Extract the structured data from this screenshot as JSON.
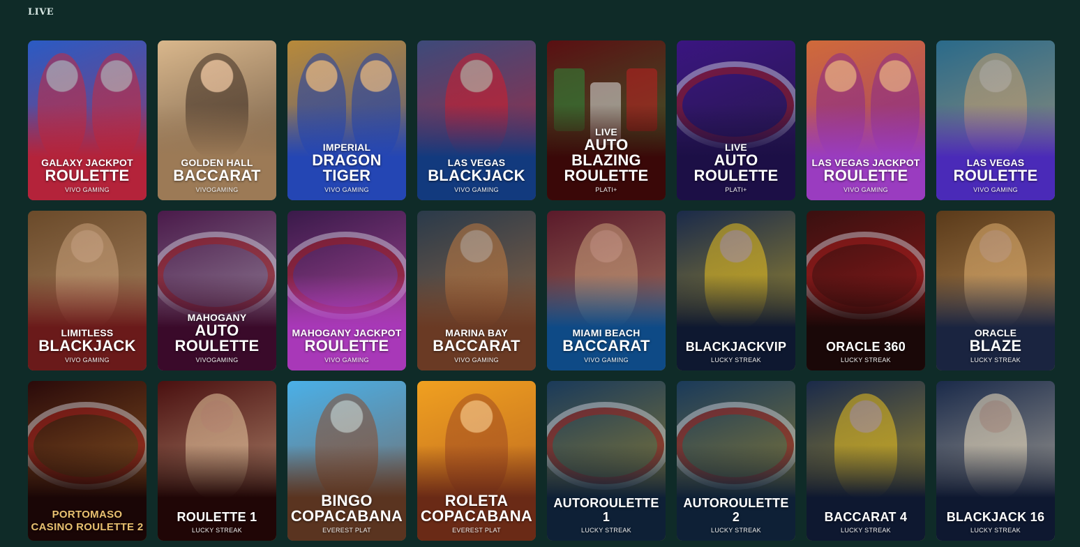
{
  "section": {
    "title": "LIVE"
  },
  "games": [
    {
      "top": "GALAXY JACKPOT",
      "main": "ROULETTE",
      "provider": "VIVO GAMING",
      "bg": "#2a5bc4",
      "accent": "#c62a3e",
      "shade": "#b4233a",
      "kind": "people",
      "name": "galaxy-jackpot-roulette"
    },
    {
      "top": "GOLDEN HALL",
      "main": "BACCARAT",
      "provider": "VIVOGAMING",
      "bg": "#d9b78c",
      "accent": "#3a2a20",
      "shade": "#9c7a56",
      "kind": "person",
      "name": "golden-hall-baccarat"
    },
    {
      "top": "IMPERIAL",
      "main": "DRAGON\nTIGER",
      "provider": "VIVO GAMING",
      "bg": "#b88a3a",
      "accent": "#1d3fa8",
      "shade": "#2446b4",
      "kind": "people",
      "name": "imperial-dragon-tiger"
    },
    {
      "top": "LAS VEGAS",
      "main": "BLACKJACK",
      "provider": "VIVO GAMING",
      "bg": "#3d4a7a",
      "accent": "#d01c2a",
      "shade": "#123a7e",
      "kind": "person",
      "name": "las-vegas-blackjack"
    },
    {
      "top": "LIVE",
      "main": "AUTO\nBLAZING\nROULETTE",
      "provider": "PLATI+",
      "bg": "#5a0f12",
      "accent": "#2e8a3a",
      "shade": "#3a0808",
      "kind": "chips",
      "name": "live-auto-blazing-roulette"
    },
    {
      "top": "LIVE",
      "main": "AUTO\nROULETTE",
      "provider": "PLATI+",
      "bg": "#3a1580",
      "accent": "#1a1a2a",
      "shade": "#1c0f46",
      "kind": "wheel",
      "name": "live-auto-roulette"
    },
    {
      "top": "LAS VEGAS JACKPOT",
      "main": "ROULETTE",
      "provider": "VIVO GAMING",
      "bg": "#d06a3a",
      "accent": "#8a2a8a",
      "shade": "#9a3cc0",
      "kind": "people",
      "name": "las-vegas-jackpot-roulette"
    },
    {
      "top": "LAS VEGAS",
      "main": "ROULETTE",
      "provider": "VIVO GAMING",
      "bg": "#2a6a8a",
      "accent": "#c8a070",
      "shade": "#4a2ab8",
      "kind": "person",
      "name": "las-vegas-roulette"
    },
    {
      "top": "LIMITLESS",
      "main": "BLACKJACK",
      "provider": "VIVO GAMING",
      "bg": "#6a4a2a",
      "accent": "#c8a07a",
      "shade": "#6a1a1a",
      "kind": "person",
      "name": "limitless-blackjack"
    },
    {
      "top": "MAHOGANY",
      "main": "AUTO\nROULETTE",
      "provider": "VIVOGAMING",
      "bg": "#4a1a4a",
      "accent": "#c0c0c8",
      "shade": "#3a0a2a",
      "kind": "wheel",
      "name": "mahogany-auto-roulette"
    },
    {
      "top": "MAHOGANY JACKPOT",
      "main": "ROULETTE",
      "provider": "VIVO GAMING",
      "bg": "#3a1a4a",
      "accent": "#e060c0",
      "shade": "#a838b8",
      "kind": "wheel",
      "name": "mahogany-jackpot-roulette"
    },
    {
      "top": "MARINA BAY",
      "main": "BACCARAT",
      "provider": "VIVO GAMING",
      "bg": "#2a3a4a",
      "accent": "#c07a40",
      "shade": "#6a3a24",
      "kind": "person",
      "name": "marina-bay-baccarat"
    },
    {
      "top": "MIAMI BEACH",
      "main": "BACCARAT",
      "provider": "VIVO GAMING",
      "bg": "#5a1a2a",
      "accent": "#c8a07a",
      "shade": "#0e4a86",
      "kind": "person",
      "name": "miami-beach-baccarat"
    },
    {
      "top": "",
      "main": "BLACKJACKVIP",
      "provider": "LUCKY STREAK",
      "bg": "#1a2a4a",
      "accent": "#e8c020",
      "shade": "#0e1830",
      "kind": "person",
      "small": true,
      "name": "blackjackvip"
    },
    {
      "top": "",
      "main": "ORACLE 360",
      "provider": "LUCKY STREAK",
      "bg": "#3a1010",
      "accent": "#c02020",
      "shade": "#1a0808",
      "kind": "wheel",
      "small": true,
      "name": "oracle-360"
    },
    {
      "top": "ORACLE",
      "main": "BLAZE",
      "provider": "LUCKY STREAK",
      "bg": "#5a3a1a",
      "accent": "#e0b070",
      "shade": "#1a2440",
      "kind": "person",
      "name": "oracle-blaze"
    },
    {
      "top": "",
      "main": "PORTOMASO\nCASINO ROULETTE 2",
      "provider": "",
      "bg": "#2a0a0a",
      "accent": "#c08030",
      "shade": "#1a0606",
      "kind": "wheel",
      "gold": true,
      "name": "portomaso-casino-roulette-2"
    },
    {
      "top": "",
      "main": "ROULETTE 1",
      "provider": "LUCKY STREAK",
      "bg": "#4a1010",
      "accent": "#e8c8a0",
      "shade": "#200606",
      "kind": "person",
      "small": true,
      "name": "roulette-1"
    },
    {
      "top": "",
      "main": "BINGO\nCOPACABANA",
      "provider": "EVEREST PLAT",
      "bg": "#4ab0e8",
      "accent": "#8a4a2a",
      "shade": "#5a3420",
      "kind": "person",
      "name": "bingo-copacabana"
    },
    {
      "top": "",
      "main": "ROLETA\nCOPACABANA",
      "provider": "EVEREST PLAT",
      "bg": "#f0a020",
      "accent": "#a04a20",
      "shade": "#6a2a16",
      "kind": "person",
      "name": "roleta-copacabana"
    },
    {
      "top": "",
      "main": "AUTOROULETTE 1",
      "provider": "LUCKY STREAK",
      "bg": "#1a3a5a",
      "accent": "#c8a020",
      "shade": "#0e2036",
      "kind": "wheel",
      "small": true,
      "name": "autoroulette-1"
    },
    {
      "top": "",
      "main": "AUTOROULETTE 2",
      "provider": "LUCKY STREAK",
      "bg": "#1a3a5a",
      "accent": "#c8a020",
      "shade": "#0e2036",
      "kind": "wheel",
      "small": true,
      "name": "autoroulette-2"
    },
    {
      "top": "",
      "main": "BACCARAT 4",
      "provider": "LUCKY STREAK",
      "bg": "#1a2a4a",
      "accent": "#e8c020",
      "shade": "#0e1830",
      "kind": "person",
      "small": true,
      "name": "baccarat-4"
    },
    {
      "top": "",
      "main": "BLACKJACK 16",
      "provider": "LUCKY STREAK",
      "bg": "#1a2a4a",
      "accent": "#f0e0c0",
      "shade": "#0e1830",
      "kind": "person",
      "small": true,
      "name": "blackjack-16"
    }
  ]
}
